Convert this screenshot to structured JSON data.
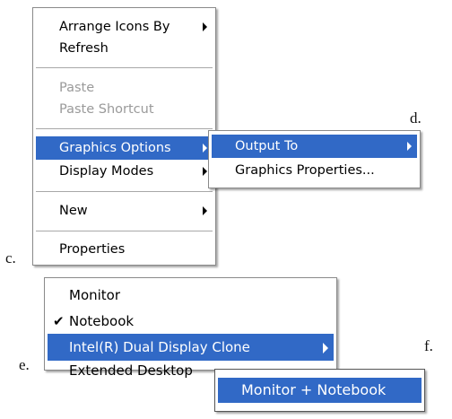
{
  "labels": {
    "c": "c.",
    "d": "d.",
    "e": "e.",
    "f": "f."
  },
  "menu1": {
    "arrange": "Arrange Icons By",
    "refresh": "Refresh",
    "paste": "Paste",
    "paste_shortcut": "Paste Shortcut",
    "graphics_options": "Graphics Options",
    "display_modes": "Display Modes",
    "new": "New",
    "properties": "Properties"
  },
  "submenu1": {
    "output_to": "Output To",
    "graphics_properties": "Graphics Properties..."
  },
  "menu2": {
    "monitor": "Monitor",
    "notebook": "Notebook",
    "notebook_check": "✔",
    "dual_clone": "Intel(R) Dual Display Clone",
    "extended": "Extended Desktop"
  },
  "submenu2": {
    "monitor_notebook": "Monitor + Notebook"
  },
  "colors": {
    "highlight": "#3169c6",
    "disabled": "#9a9a9a"
  }
}
